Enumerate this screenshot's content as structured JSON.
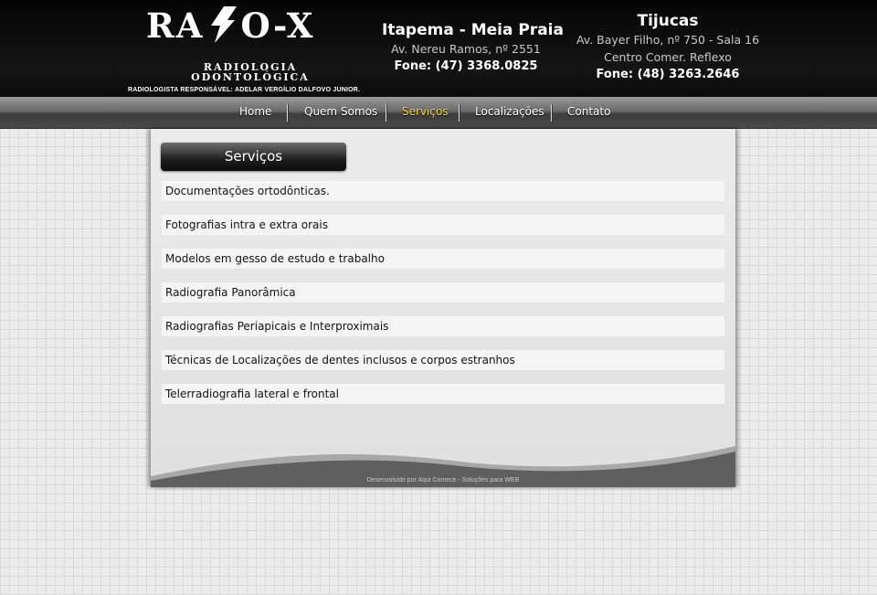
{
  "header": {
    "logo": {
      "left_text": "RA",
      "right_text": "O-X",
      "bolt_icon": "lightning-bolt-icon",
      "subtitle_line1": "RADIOLOGIA",
      "subtitle_line2": "ODONTOLÓGICA",
      "responsible": "RADIOLOGISTA RESPONSÁVEL: ADELAR VERGÍLIO DALFOVO JUNIOR."
    },
    "locations": [
      {
        "city": "Itapema - Meia Praia",
        "address": "Av. Nereu Ramos, nº 2551",
        "phone": "Fone: (47) 3368.0825"
      },
      {
        "city": "Tijucas",
        "address": "Av. Bayer Filho, nº 750 - Sala 16",
        "extra": "Centro Comer. Reflexo",
        "phone": "Fone: (48) 3263.2646"
      }
    ]
  },
  "nav": {
    "items": [
      {
        "label": "Home",
        "active": false
      },
      {
        "label": "Quem Somos",
        "active": false
      },
      {
        "label": "Serviços",
        "active": true
      },
      {
        "label": "Localizações",
        "active": false
      },
      {
        "label": "Contato",
        "active": false
      }
    ]
  },
  "main": {
    "section_title": "Serviços",
    "services": [
      "Documentações ortodônticas.",
      "Fotografias intra e extra orais",
      "Modelos em gesso de estudo e trabalho",
      "Radiografia Panorâmica",
      "Radiografias Periapicais e Interproximais",
      "Técnicas de Localizações de dentes inclusos e corpos estranhos",
      "Telerradiografia lateral e frontal"
    ]
  },
  "footer": {
    "credit": "Desenvolvido por Aqui Comece - Soluções para WEB"
  },
  "colors": {
    "active_nav": "#f2d23c",
    "header_bg": "#0b0b0b",
    "footer_wave": "#5f5f5f"
  }
}
